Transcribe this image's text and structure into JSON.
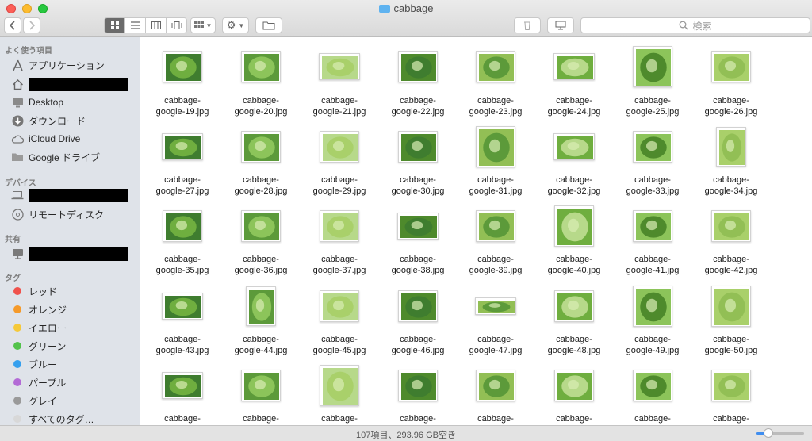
{
  "window": {
    "title": "cabbage"
  },
  "toolbar": {
    "back_icon": "chevron-left-icon",
    "forward_icon": "chevron-right-icon",
    "view_modes": [
      "icon-view",
      "list-view",
      "column-view",
      "cover-flow-view"
    ],
    "search_placeholder": "検索",
    "colors": {
      "active_segment": "#6b6b6b",
      "accent": "#3f8ef0"
    }
  },
  "sidebar": {
    "favorites_header": "よく使う項目",
    "favorites": [
      {
        "label": "アプリケーション",
        "icon": "applications-icon"
      },
      {
        "label": "",
        "icon": "home-icon",
        "redacted": true
      },
      {
        "label": "Desktop",
        "icon": "desktop-icon"
      },
      {
        "label": "ダウンロード",
        "icon": "download-icon"
      },
      {
        "label": "iCloud Drive",
        "icon": "cloud-icon"
      },
      {
        "label": "Google ドライブ",
        "icon": "folder-icon"
      }
    ],
    "devices_header": "デバイス",
    "devices": [
      {
        "label": "",
        "icon": "laptop-icon",
        "redacted": true
      },
      {
        "label": "リモートディスク",
        "icon": "disc-icon"
      }
    ],
    "shared_header": "共有",
    "shared": [
      {
        "label": "",
        "icon": "computer-icon",
        "redacted": true
      }
    ],
    "tags_header": "タグ",
    "tags": [
      {
        "label": "レッド",
        "color": "#f0524c"
      },
      {
        "label": "オレンジ",
        "color": "#f59a2a"
      },
      {
        "label": "イエロー",
        "color": "#f5c93a"
      },
      {
        "label": "グリーン",
        "color": "#52c24a"
      },
      {
        "label": "ブルー",
        "color": "#36a0ee"
      },
      {
        "label": "パープル",
        "color": "#b36bd6"
      },
      {
        "label": "グレイ",
        "color": "#9a9a9a"
      },
      {
        "label": "すべてのタグ…",
        "color": "#d8d8d8"
      }
    ]
  },
  "files": {
    "rows": [
      [
        {
          "l1": "cabbage-",
          "l2": "google-19.jpg",
          "shape": "sq"
        },
        {
          "l1": "cabbage-",
          "l2": "google-20.jpg",
          "shape": "sq"
        },
        {
          "l1": "cabbage-",
          "l2": "google-21.jpg",
          "shape": "wide"
        },
        {
          "l1": "cabbage-",
          "l2": "google-22.jpg",
          "shape": "sq"
        },
        {
          "l1": "cabbage-",
          "l2": "google-23.jpg",
          "shape": "sq"
        },
        {
          "l1": "cabbage-",
          "l2": "google-24.jpg",
          "shape": "wide"
        },
        {
          "l1": "cabbage-",
          "l2": "google-25.jpg",
          "shape": "tall"
        },
        {
          "l1": "cabbage-",
          "l2": "google-26.jpg",
          "shape": "sq"
        }
      ],
      [
        {
          "l1": "cabbage-",
          "l2": "google-27.jpg",
          "shape": "wide"
        },
        {
          "l1": "cabbage-",
          "l2": "google-28.jpg",
          "shape": "sq"
        },
        {
          "l1": "cabbage-",
          "l2": "google-29.jpg",
          "shape": "sq"
        },
        {
          "l1": "cabbage-",
          "l2": "google-30.jpg",
          "shape": "sq"
        },
        {
          "l1": "cabbage-",
          "l2": "google-31.jpg",
          "shape": "tall"
        },
        {
          "l1": "cabbage-",
          "l2": "google-32.jpg",
          "shape": "wide"
        },
        {
          "l1": "cabbage-",
          "l2": "google-33.jpg",
          "shape": "sq"
        },
        {
          "l1": "cabbage-",
          "l2": "google-34.jpg",
          "shape": "tallnarrow"
        }
      ],
      [
        {
          "l1": "cabbage-",
          "l2": "google-35.jpg",
          "shape": "sq"
        },
        {
          "l1": "cabbage-",
          "l2": "google-36.jpg",
          "shape": "sq"
        },
        {
          "l1": "cabbage-",
          "l2": "google-37.jpg",
          "shape": "sq"
        },
        {
          "l1": "cabbage-",
          "l2": "google-38.jpg",
          "shape": "wide"
        },
        {
          "l1": "cabbage-",
          "l2": "google-39.jpg",
          "shape": "sq"
        },
        {
          "l1": "cabbage-",
          "l2": "google-40.jpg",
          "shape": "tall"
        },
        {
          "l1": "cabbage-",
          "l2": "google-41.jpg",
          "shape": "sq"
        },
        {
          "l1": "cabbage-",
          "l2": "google-42.jpg",
          "shape": "sq"
        }
      ],
      [
        {
          "l1": "cabbage-",
          "l2": "google-43.jpg",
          "shape": "wide"
        },
        {
          "l1": "cabbage-",
          "l2": "google-44.jpg",
          "shape": "tallnarrow"
        },
        {
          "l1": "cabbage-",
          "l2": "google-45.jpg",
          "shape": "sq"
        },
        {
          "l1": "cabbage-",
          "l2": "google-46.jpg",
          "shape": "sq"
        },
        {
          "l1": "cabbage-",
          "l2": "google-47.jpg",
          "shape": "strip"
        },
        {
          "l1": "cabbage-",
          "l2": "google-48.jpg",
          "shape": "sq"
        },
        {
          "l1": "cabbage-",
          "l2": "google-49.jpg",
          "shape": "tall"
        },
        {
          "l1": "cabbage-",
          "l2": "google-50.jpg",
          "shape": "tall"
        }
      ],
      [
        {
          "l1": "cabbage-",
          "l2": "",
          "shape": "wide"
        },
        {
          "l1": "cabbage-",
          "l2": "",
          "shape": "sq"
        },
        {
          "l1": "cabbage-",
          "l2": "",
          "shape": "tall"
        },
        {
          "l1": "cabbage-",
          "l2": "",
          "shape": "sq"
        },
        {
          "l1": "cabbage-",
          "l2": "",
          "shape": "sq"
        },
        {
          "l1": "cabbage-",
          "l2": "",
          "shape": "sq"
        },
        {
          "l1": "cabbage-",
          "l2": "",
          "shape": "sq"
        },
        {
          "l1": "cabbage-",
          "l2": "",
          "shape": "sq"
        }
      ]
    ],
    "thumb_colors": [
      "#6fae3f",
      "#8cc45a",
      "#a9d06a",
      "#3f7d2f",
      "#5c9a3a",
      "#b7d98a",
      "#4e8a2c",
      "#92bf55"
    ]
  },
  "status": {
    "text": "107項目、293.96 GB空き",
    "zoom_level": 0.25
  }
}
